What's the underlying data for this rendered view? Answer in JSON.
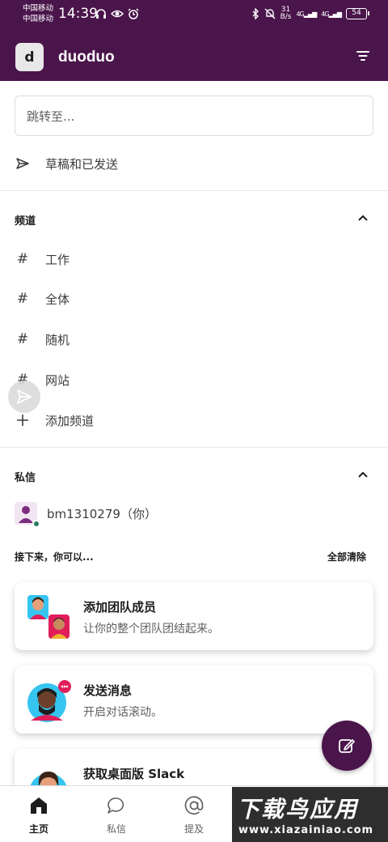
{
  "status_bar": {
    "carrier1": "中国移动",
    "carrier2": "中国移动",
    "time": "14:39",
    "speed_value": "31",
    "speed_unit": "B/s",
    "net1": "4G",
    "net2": "4G",
    "battery": "54"
  },
  "header": {
    "avatar_letter": "d",
    "workspace_name": "duoduo"
  },
  "jump": {
    "placeholder": "跳转至..."
  },
  "drafts": {
    "label": "草稿和已发送"
  },
  "channels": {
    "title": "频道",
    "items": [
      {
        "label": "工作"
      },
      {
        "label": "全体"
      },
      {
        "label": "随机"
      },
      {
        "label": "网站"
      }
    ],
    "add_label": "添加频道"
  },
  "dms": {
    "title": "私信",
    "user": "bm1310279（你）"
  },
  "next": {
    "title": "接下来，你可以...",
    "clear_all": "全部清除",
    "cards": [
      {
        "title": "添加团队成员",
        "subtitle": "让你的整个团队团结起来。"
      },
      {
        "title": "发送消息",
        "subtitle": "开启对话滚动。"
      },
      {
        "title": "获取桌面版 Slack",
        "subtitle": ""
      }
    ]
  },
  "bottom_nav": {
    "home": "主页",
    "dms": "私信",
    "mentions": "提及"
  },
  "watermark": {
    "title": "下载鸟应用",
    "url": "www.xiazainiao.com"
  },
  "colors": {
    "brand": "#4a154b",
    "online": "#2b7a5c"
  }
}
